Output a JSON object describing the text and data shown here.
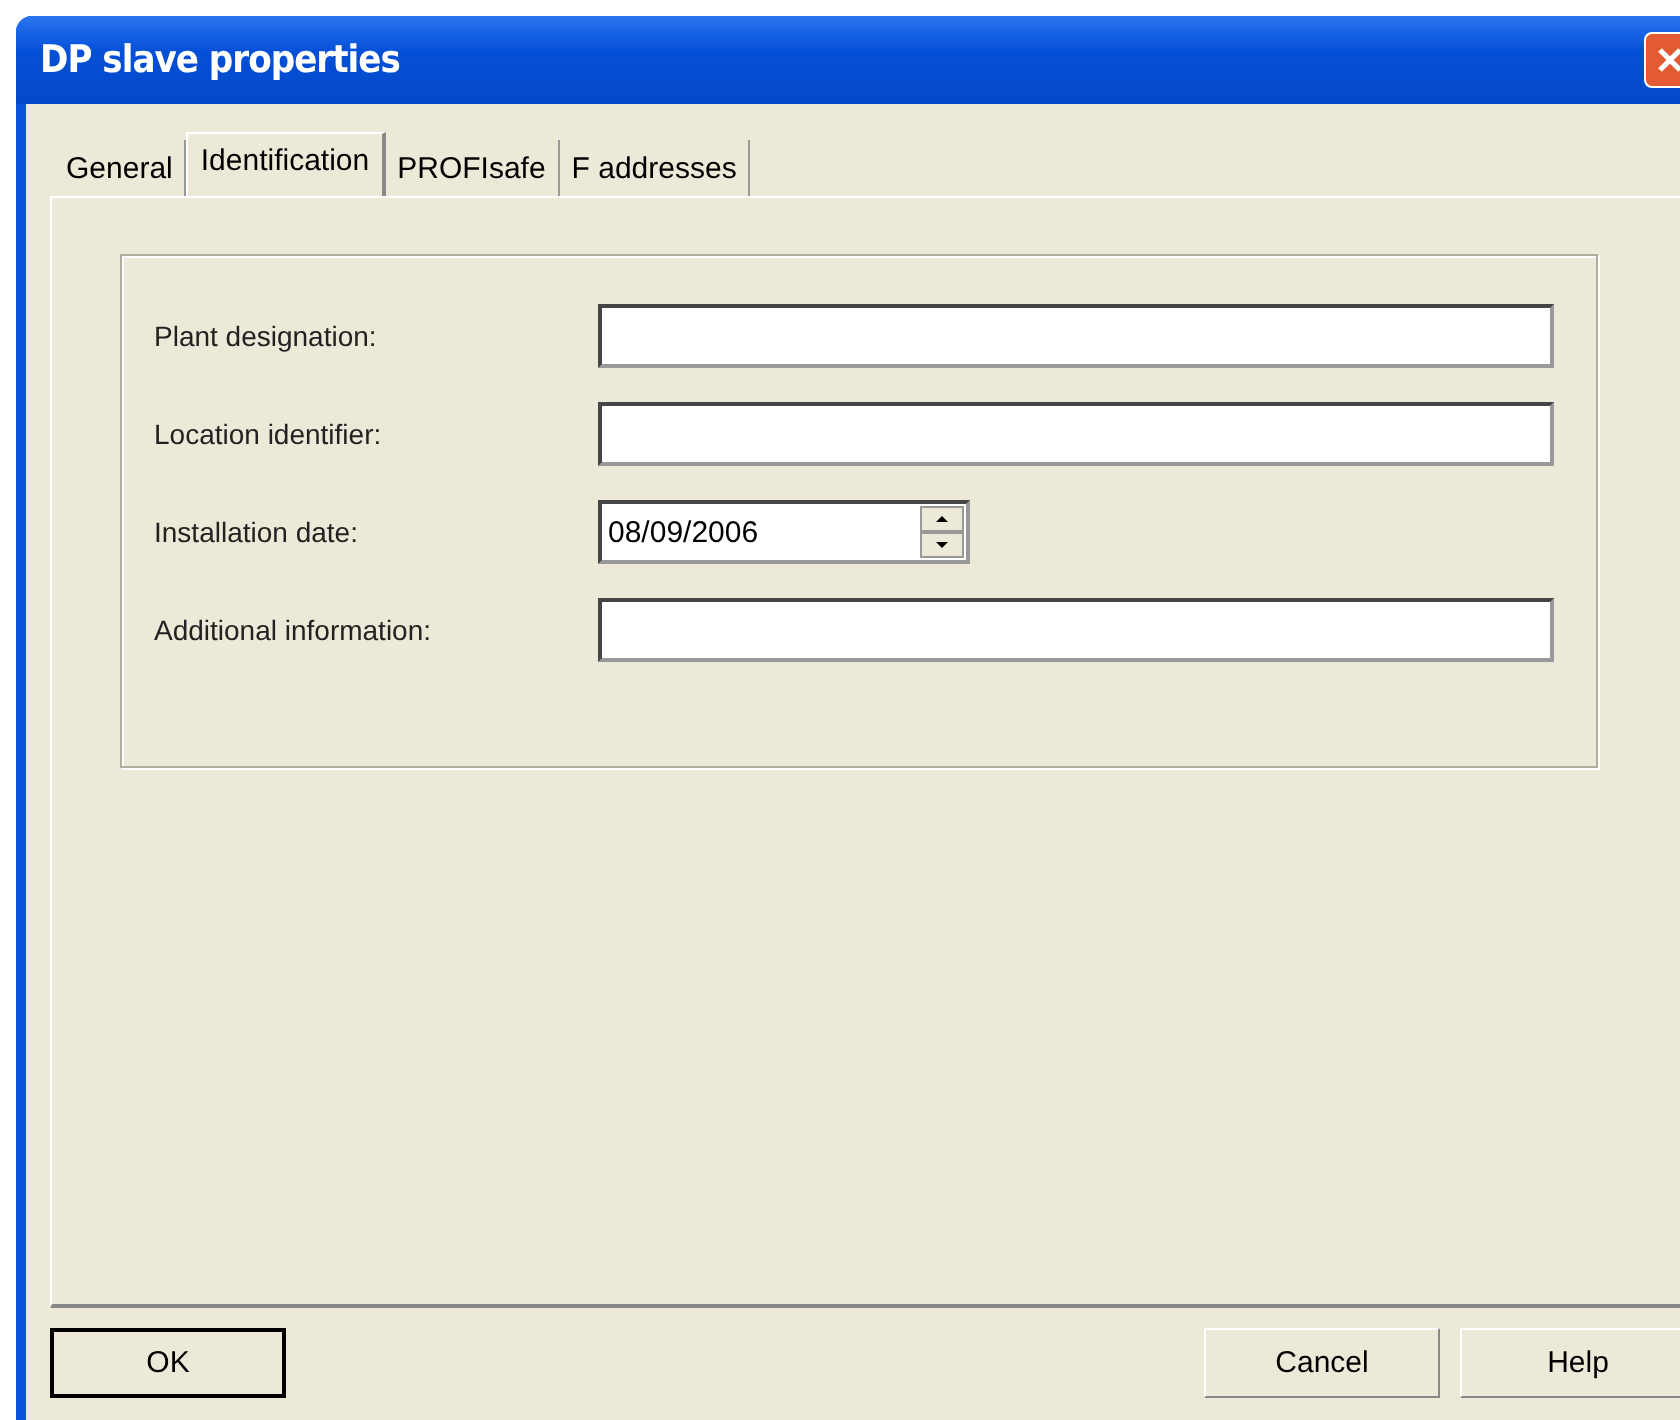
{
  "window": {
    "title": "DP slave properties"
  },
  "tabs": [
    {
      "label": "General",
      "selected": false
    },
    {
      "label": "Identification",
      "selected": true
    },
    {
      "label": "PROFIsafe",
      "selected": false
    },
    {
      "label": "F addresses",
      "selected": false
    }
  ],
  "fields": [
    {
      "kind": "text",
      "label": "Plant designation:"
    },
    {
      "kind": "text",
      "label": "Location identifier:"
    },
    {
      "kind": "date",
      "label": "Installation date:",
      "value": "08/09/2006"
    },
    {
      "kind": "text",
      "label": "Additional information:"
    }
  ],
  "buttons": [
    {
      "label": "OK",
      "default": true
    },
    {
      "label": "Cancel",
      "default": false
    },
    {
      "label": "Help",
      "default": false
    }
  ]
}
